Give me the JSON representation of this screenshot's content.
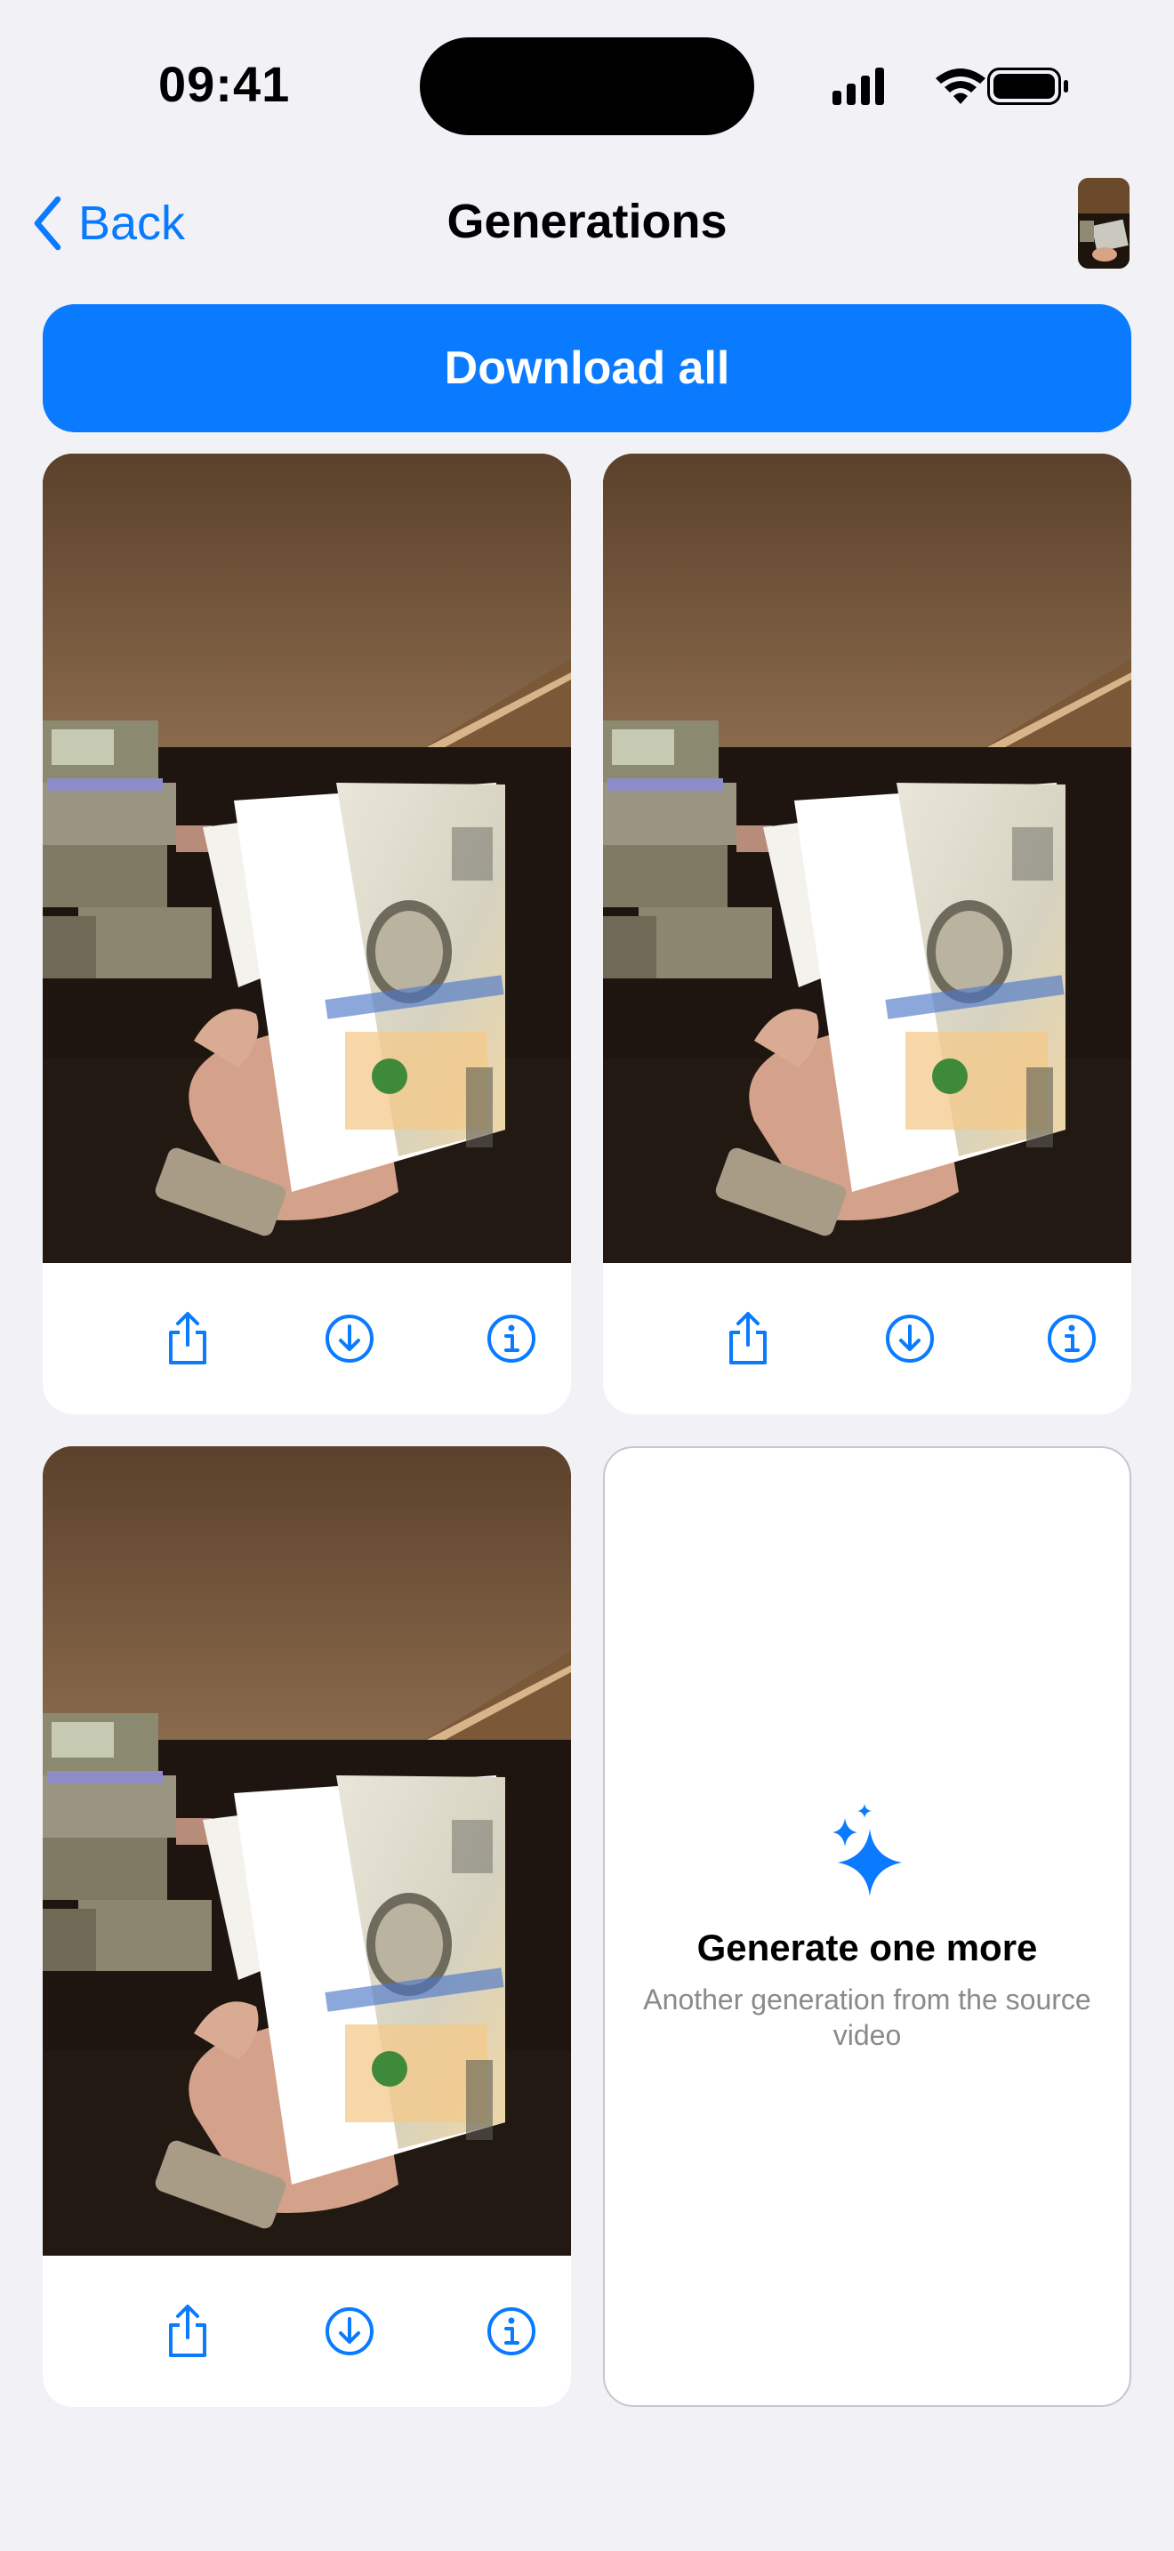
{
  "status_bar": {
    "time": "09:41"
  },
  "nav": {
    "back_label": "Back",
    "title": "Generations"
  },
  "download_all": {
    "label": "Download all"
  },
  "generations": [
    {
      "actions": [
        "share-icon",
        "download-icon",
        "info-icon"
      ]
    },
    {
      "actions": [
        "share-icon",
        "download-icon",
        "info-icon"
      ]
    },
    {
      "actions": [
        "share-icon",
        "download-icon",
        "info-icon"
      ]
    }
  ],
  "generate_more": {
    "icon": "sparkles-icon",
    "title": "Generate one more",
    "subtitle": "Another generation from the source video"
  },
  "colors": {
    "accent": "#0a7aff",
    "background": "#f1f1f6",
    "secondary_text": "#8a8a8e"
  }
}
